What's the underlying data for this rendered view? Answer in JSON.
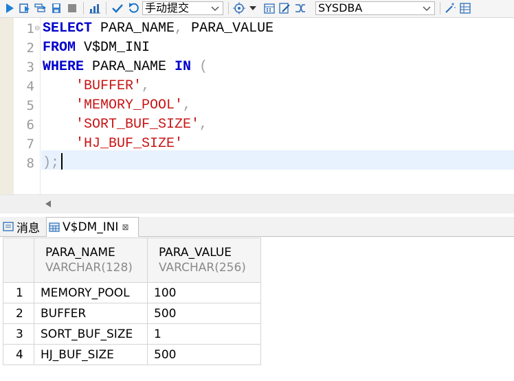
{
  "toolbar": {
    "mode_combo": "手动提交",
    "schema_combo": "SYSDBA",
    "icons": [
      "run-icon",
      "run-step-icon",
      "run-script-icon",
      "save-icon",
      "stop-icon",
      "explain-icon",
      "commit-icon",
      "rollback-icon",
      "target-icon",
      "dropdown-icon",
      "calendar-icon",
      "edit-icon",
      "shuffle-icon",
      "wand-icon",
      "grid-icon"
    ]
  },
  "editor": {
    "line_numbers": [
      "1",
      "2",
      "3",
      "4",
      "5",
      "6",
      "7",
      "8"
    ],
    "lines": [
      [
        {
          "t": "SELECT",
          "c": "kw"
        },
        {
          "t": " PARA_NAME",
          "c": ""
        },
        {
          "t": ",",
          "c": "punc"
        },
        {
          "t": " PARA_VALUE",
          "c": ""
        }
      ],
      [
        {
          "t": "FROM",
          "c": "kw"
        },
        {
          "t": " V$DM_INI",
          "c": ""
        }
      ],
      [
        {
          "t": "WHERE",
          "c": "kw"
        },
        {
          "t": " PARA_NAME ",
          "c": ""
        },
        {
          "t": "IN",
          "c": "kw"
        },
        {
          "t": " (",
          "c": "punc"
        }
      ],
      [
        {
          "t": "    ",
          "c": ""
        },
        {
          "t": "'BUFFER'",
          "c": "str"
        },
        {
          "t": ",",
          "c": "punc"
        }
      ],
      [
        {
          "t": "    ",
          "c": ""
        },
        {
          "t": "'MEMORY_POOL'",
          "c": "str"
        },
        {
          "t": ",",
          "c": "punc"
        }
      ],
      [
        {
          "t": "    ",
          "c": ""
        },
        {
          "t": "'SORT_BUF_SIZE'",
          "c": "str"
        },
        {
          "t": ",",
          "c": "punc"
        }
      ],
      [
        {
          "t": "    ",
          "c": ""
        },
        {
          "t": "'HJ_BUF_SIZE'",
          "c": "str"
        }
      ],
      [
        {
          "t": ");",
          "c": "punc"
        }
      ]
    ]
  },
  "tabs": {
    "messages": "消息",
    "result": "V$DM_INI",
    "close": "⊠"
  },
  "result": {
    "columns": [
      {
        "name": "PARA_NAME",
        "type": "VARCHAR(128)"
      },
      {
        "name": "PARA_VALUE",
        "type": "VARCHAR(256)"
      }
    ],
    "rows": [
      {
        "no": "1",
        "name": "MEMORY_POOL",
        "value": "100"
      },
      {
        "no": "2",
        "name": "BUFFER",
        "value": "500"
      },
      {
        "no": "3",
        "name": "SORT_BUF_SIZE",
        "value": "1"
      },
      {
        "no": "4",
        "name": "HJ_BUF_SIZE",
        "value": "500"
      }
    ]
  }
}
